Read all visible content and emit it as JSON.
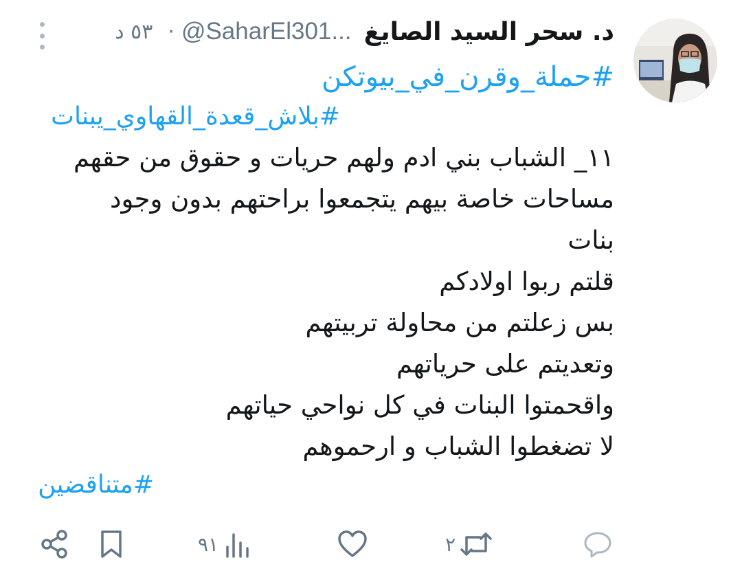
{
  "tweet": {
    "author_name": "د. سحر السيد الصايغ",
    "handle": "@SaharEl301...",
    "separator": "·",
    "time": "٥٣ د",
    "hashtags_top": [
      "#حملة_وقرن_في_بيوتكن",
      "#بلاش_قعدة_القهاوي_يبنات"
    ],
    "lines": [
      "١١_ الشباب بني ادم ولهم حريات و حقوق من حقهم",
      "مساحات خاصة بيهم يتجمعوا براحتهم بدون وجود",
      "بنات",
      "قلتم ربوا اولادكم",
      "بس زعلتم من محاولة تربيتهم",
      "وتعديتم على حرياتهم",
      "واقحمتوا البنات في كل نواحي حياتهم",
      "لا تضغطوا الشباب و ارحموهم"
    ],
    "hashtag_bottom": "#متناقضين"
  },
  "actions": {
    "reply_icon": "reply-icon",
    "retweet_count": "٢",
    "like_icon": "heart-icon",
    "views_count": "٩١",
    "bookmark_icon": "bookmark-icon",
    "share_icon": "share-icon"
  },
  "colors": {
    "link": "#1da1f2",
    "text": "#14171a",
    "muted": "#657786"
  }
}
